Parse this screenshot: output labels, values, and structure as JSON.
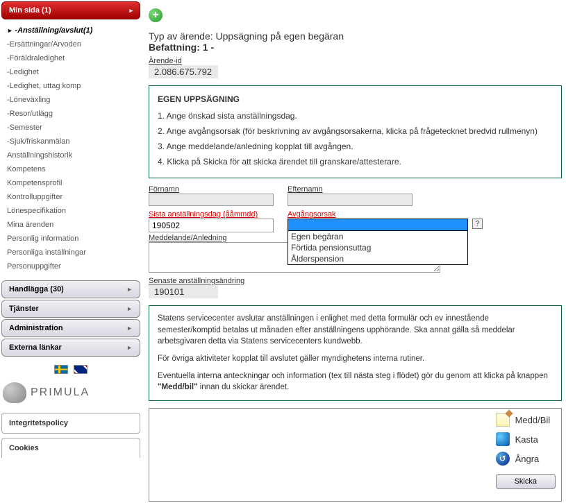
{
  "sidebar": {
    "red_header": "Min sida (1)",
    "parent_item": "-Anställning/avslut(1)",
    "items": [
      "-Ersättningar/Arvoden",
      "-Föräldraledighet",
      "-Ledighet",
      "-Ledighet, uttag komp",
      "-Löneväxling",
      "-Resor/utlägg",
      "-Semester",
      "-Sjuk/friskanmälan",
      "Anställningshistorik",
      "Kompetens",
      "Kompetensprofil",
      "Kontrolluppgifter",
      "Lönespecifikation",
      "Mina ärenden",
      "Personlig information",
      "Personliga inställningar",
      "Personuppgifter"
    ],
    "sections": [
      "Handlägga (30)",
      "Tjänster",
      "Administration",
      "Externa länkar"
    ],
    "brand": "PRIMULA",
    "footer_links": [
      "Integritetspolicy",
      "Cookies"
    ]
  },
  "main": {
    "case_type_label": "Typ av ärende:",
    "case_type_value": "Uppsägning på egen begäran",
    "befattning_label": "Befattning:",
    "befattning_value": "1 -",
    "arende_id_label": "Ärende-id",
    "arende_id_value": "2.086.675.792",
    "instructions_title": "EGEN UPPSÄGNING",
    "instructions": [
      "1. Ange önskad sista anställningsdag.",
      "2. Ange avgångsorsak (för beskrivning av avgångsorsakerna, klicka på frågetecknet bredvid rullmenyn)",
      "3. Ange meddelande/anledning kopplat till avgången.",
      "4. Klicka på Skicka för att skicka ärendet till granskare/attesterare."
    ],
    "fornamn_label": "Förnamn",
    "efternamn_label": "Efternamn",
    "fornamn_value": "",
    "efternamn_value": "",
    "sista_label": "Sista anställningsdag (ååmmdd)",
    "sista_value": "190502",
    "avgang_label": "Avgångsorsak",
    "avgang_options": [
      "Egen begäran",
      "Förtida pensionsuttag",
      "Ålderspension"
    ],
    "help_char": "?",
    "medd_label": "Meddelande/Anledning",
    "medd_value": "",
    "senaste_label": "Senaste anställningsändring",
    "senaste_value": "190101",
    "info_p1": "Statens servicecenter avslutar anställningen i enlighet med detta formulär och ev innestående semester/komptid betalas ut månaden efter anställningens upphörande. Ska annat gälla så meddelar arbetsgivaren detta via Statens servicecenters kundwebb.",
    "info_p2": "För övriga aktiviteter kopplat till avslutet gäller myndighetens interna rutiner.",
    "info_p3a": "Eventuella interna anteckningar och information (tex till nästa steg i flödet) gör du genom att klicka på knappen ",
    "info_p3b": "\"Medd/bil\"",
    "info_p3c": " innan du skickar ärendet.",
    "action_medd": "Medd/Bil",
    "action_kasta": "Kasta",
    "action_angra": "Ångra",
    "action_skicka": "Skicka"
  }
}
